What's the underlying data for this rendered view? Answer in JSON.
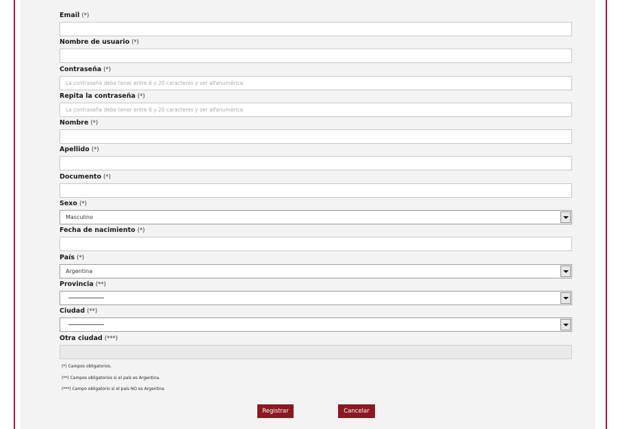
{
  "form": {
    "email": {
      "label": "Email",
      "req": "(*)",
      "value": ""
    },
    "username": {
      "label": "Nombre de usuario",
      "req": "(*)",
      "value": ""
    },
    "password": {
      "label": "Contraseña",
      "req": "(*)",
      "placeholder": "La contraseña debe tener entre 6 y 20 caracteres y ser alfanumérica"
    },
    "password_repeat": {
      "label": "Repita la contraseña",
      "req": "(*)",
      "placeholder": "La contraseña debe tener entre 6 y 20 caracteres y ser alfanumérica"
    },
    "first_name": {
      "label": "Nombre",
      "req": "(*)",
      "value": ""
    },
    "last_name": {
      "label": "Apellido",
      "req": "(*)",
      "value": ""
    },
    "document": {
      "label": "Documento",
      "req": "(*)",
      "value": ""
    },
    "sex": {
      "label": "Sexo",
      "req": "(*)",
      "selected": "Masculino"
    },
    "birth_date": {
      "label": "Fecha de nacimiento",
      "req": "(*)",
      "value": ""
    },
    "country": {
      "label": "País",
      "req": "(*)",
      "selected": "Argentina"
    },
    "province": {
      "label": "Provincia",
      "req": "(**)",
      "selected": ""
    },
    "city": {
      "label": "Ciudad",
      "req": "(**)",
      "selected": ""
    },
    "other_city": {
      "label": "Otra ciudad",
      "req": "(***)",
      "value": ""
    }
  },
  "notes": [
    "(*) Campos obligatorios.",
    "(**) Campos obligatorios si el país es Argentina.",
    "(***) Campo obligatorio si el país NO es Argentina"
  ],
  "buttons": {
    "register": "Registrar",
    "cancel": "Cancelar"
  },
  "colors": {
    "accent": "#8a1820",
    "border_line": "#a31d2a",
    "panel_bg": "#f3f3f3"
  }
}
